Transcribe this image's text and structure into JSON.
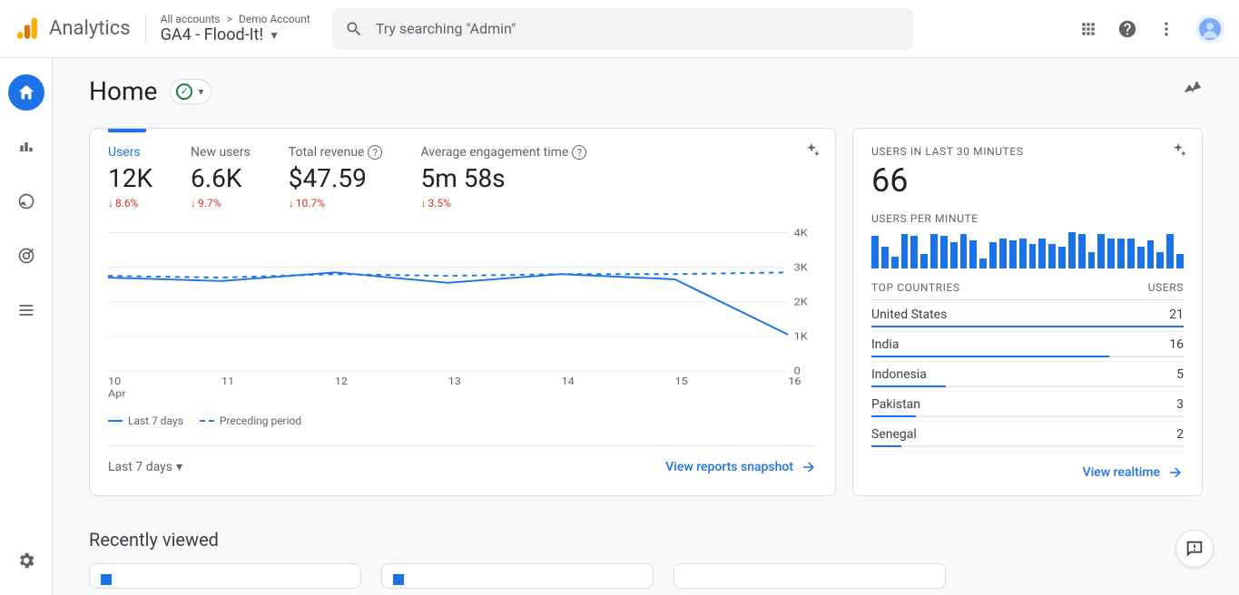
{
  "header": {
    "product": "Analytics",
    "breadcrumb_all": "All accounts",
    "breadcrumb_sep": ">",
    "breadcrumb_account": "Demo Account",
    "property": "GA4 - Flood-It!",
    "search_placeholder": "Try searching \"Admin\""
  },
  "page": {
    "title": "Home",
    "recently_viewed": "Recently viewed"
  },
  "main_card": {
    "metrics": [
      {
        "label": "Users",
        "value": "12K",
        "delta": "8.6%",
        "active": true
      },
      {
        "label": "New users",
        "value": "6.6K",
        "delta": "9.7%"
      },
      {
        "label": "Total revenue",
        "value": "$47.59",
        "delta": "10.7%",
        "info": true
      },
      {
        "label": "Average engagement time",
        "value": "5m 58s",
        "delta": "3.5%",
        "info": true
      }
    ],
    "legend_current": "Last 7 days",
    "legend_prev": "Preceding period",
    "range": "Last 7 days",
    "footer_link": "View reports snapshot"
  },
  "chart_data": {
    "type": "line",
    "ylabel": "",
    "xlabel": "",
    "ylim": [
      0,
      4000
    ],
    "y_ticks": [
      "0",
      "1K",
      "2K",
      "3K",
      "4K"
    ],
    "x_categories": [
      "10",
      "11",
      "12",
      "13",
      "14",
      "15",
      "16"
    ],
    "x_sublabel": "Apr",
    "series": [
      {
        "name": "Last 7 days",
        "style": "solid",
        "values": [
          2700,
          2600,
          2850,
          2550,
          2800,
          2650,
          1050
        ]
      },
      {
        "name": "Preceding period",
        "style": "dashed",
        "values": [
          2750,
          2700,
          2800,
          2750,
          2800,
          2800,
          2850
        ]
      }
    ]
  },
  "realtime": {
    "title": "USERS IN LAST 30 MINUTES",
    "big": "66",
    "sub": "USERS PER MINUTE",
    "bars": [
      32,
      22,
      12,
      34,
      32,
      14,
      34,
      32,
      26,
      34,
      28,
      10,
      26,
      30,
      28,
      30,
      24,
      30,
      24,
      22,
      36,
      34,
      16,
      34,
      30,
      30,
      30,
      22,
      28,
      16,
      34,
      14
    ],
    "table": {
      "head_left": "TOP COUNTRIES",
      "head_right": "USERS",
      "max": 21,
      "rows": [
        {
          "country": "United States",
          "users": 21
        },
        {
          "country": "India",
          "users": 16
        },
        {
          "country": "Indonesia",
          "users": 5
        },
        {
          "country": "Pakistan",
          "users": 3
        },
        {
          "country": "Senegal",
          "users": 2
        }
      ]
    },
    "footer_link": "View realtime"
  }
}
